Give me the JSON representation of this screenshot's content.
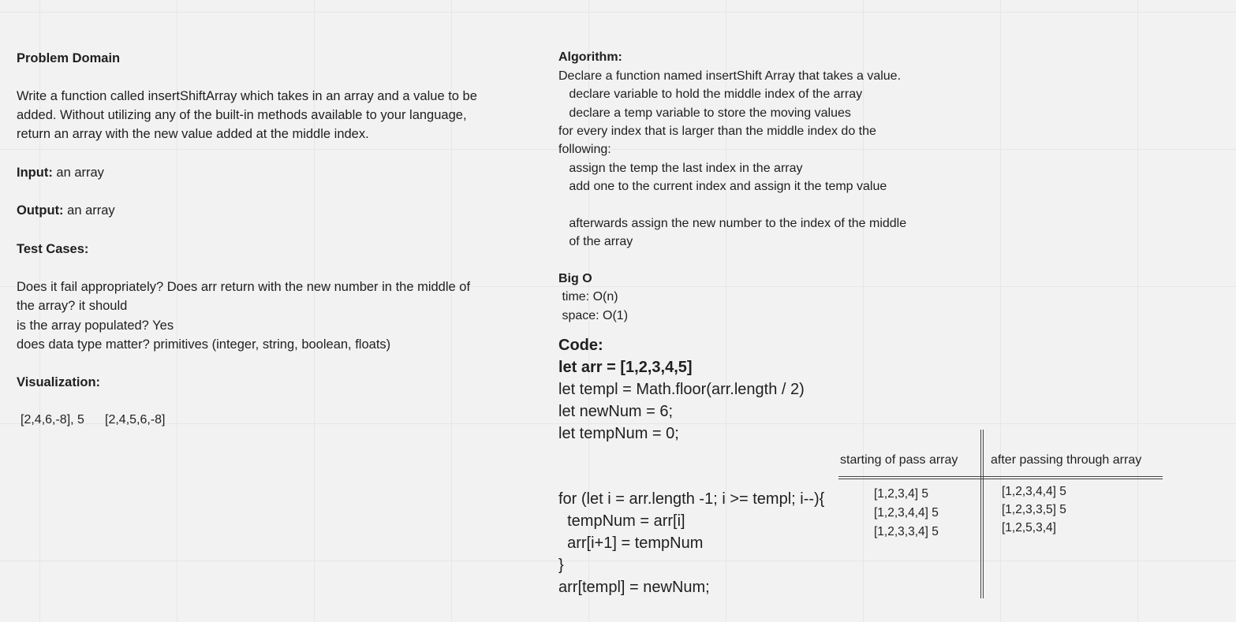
{
  "problem": {
    "heading": "Problem Domain",
    "description_lines": [
      "Write a function called insertShiftArray which takes in an array and a value to be",
      "added. Without utilizing any of the built-in methods available to your language,",
      "return an array with the new value added at the middle index."
    ],
    "input_label": "Input:",
    "input_value": " an array",
    "output_label": "Output:",
    "output_value": " an array",
    "test_cases_heading": "Test Cases:",
    "test_lines": [
      "Does it fail appropriately? Does arr return with the new number in the middle of",
      "the array? it should",
      "is the array populated? Yes",
      "does data type matter? primitives (integer, string, boolean, floats)"
    ],
    "visualization_heading": "Visualization:",
    "visualization_input": "[2,4,6,-8], 5",
    "visualization_output": "[2,4,5,6,-8]"
  },
  "algorithm": {
    "heading": "Algorithm:",
    "lines": [
      "Declare a function named insertShift Array that takes a value.",
      "   declare variable to hold the middle index of the array",
      "   declare a temp variable to store the moving values",
      "for every index that is larger than the middle index do the",
      "following:",
      "   assign the temp the last index in the array",
      "   add one to the current index and assign it the temp value",
      "",
      "   afterwards assign the new number to the index of the middle",
      "   of the array"
    ]
  },
  "big_o": {
    "heading": "Big O",
    "time": " time: O(n)",
    "space": " space: O(1)"
  },
  "code": {
    "heading": "Code:",
    "line1": "let arr = [1,2,3,4,5]",
    "line2": "let templ = Math.floor(arr.length / 2)",
    "line3": "let newNum = 6;",
    "line4": "let tempNum = 0;",
    "loop_lines": [
      "for (let i = arr.length -1; i >= templ; i--){",
      "  tempNum = arr[i]",
      "  arr[i+1] = tempNum",
      "}",
      "arr[templ] = newNum;"
    ]
  },
  "pass_table": {
    "col1_header": "starting of pass array",
    "col2_header": "after passing through array",
    "col1_rows": [
      "[1,2,3,4] 5",
      "[1,2,3,4,4] 5",
      "[1,2,3,3,4] 5"
    ],
    "col2_rows": [
      "[1,2,3,4,4] 5",
      "[1,2,3,3,5] 5",
      "[1,2,5,3,4]"
    ]
  }
}
